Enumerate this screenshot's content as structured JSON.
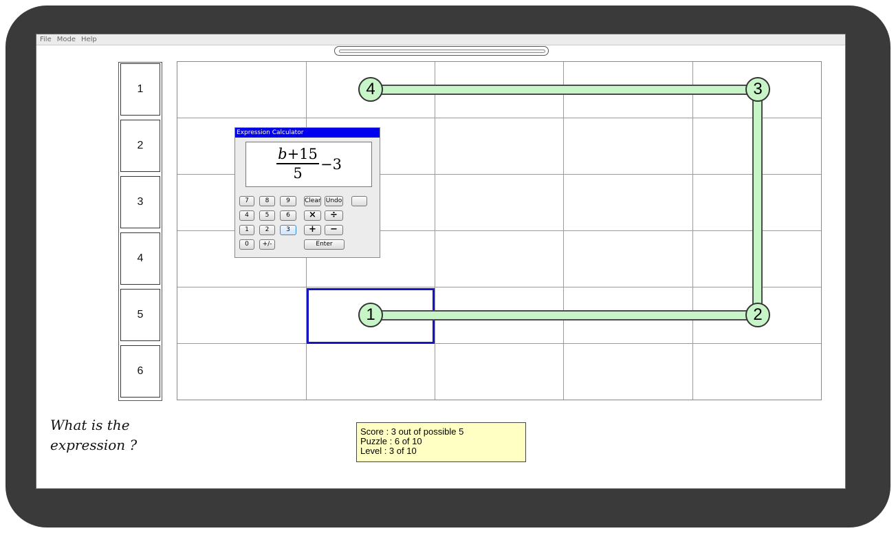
{
  "menu": [
    "File",
    "Mode",
    "Help"
  ],
  "row_labels": [
    "1",
    "2",
    "3",
    "4",
    "5",
    "6"
  ],
  "grid": {
    "columns": 5,
    "rows": 6
  },
  "path_nodes": [
    {
      "label": "1",
      "row": 5,
      "col": 2
    },
    {
      "label": "2",
      "row": 5,
      "col": 5
    },
    {
      "label": "3",
      "row": 1,
      "col": 5
    },
    {
      "label": "4",
      "row": 1,
      "col": 2
    }
  ],
  "selected_cell": {
    "row": 5,
    "col": 2
  },
  "calculator": {
    "title": "Expression Calculator",
    "expression": {
      "numerator_var": "b",
      "numerator_rest": "+15",
      "denominator": "5",
      "suffix": "−3"
    },
    "keys": [
      {
        "label": "7",
        "name": "key-7"
      },
      {
        "label": "8",
        "name": "key-8"
      },
      {
        "label": "9",
        "name": "key-9"
      },
      {
        "label": "Clear",
        "name": "clear-button"
      },
      {
        "label": "Undo",
        "name": "undo-button"
      },
      {
        "label": "",
        "name": "blank-button"
      },
      {
        "label": "4",
        "name": "key-4"
      },
      {
        "label": "5",
        "name": "key-5"
      },
      {
        "label": "6",
        "name": "key-6"
      },
      {
        "label": "×",
        "name": "multiply-button"
      },
      {
        "label": "÷",
        "name": "divide-button"
      },
      {
        "label": "1",
        "name": "key-1"
      },
      {
        "label": "2",
        "name": "key-2"
      },
      {
        "label": "3",
        "name": "key-3"
      },
      {
        "label": "+",
        "name": "plus-button"
      },
      {
        "label": "−",
        "name": "minus-button"
      },
      {
        "label": "0",
        "name": "key-0"
      },
      {
        "label": "+/-",
        "name": "sign-toggle-button"
      },
      {
        "label": "Enter",
        "name": "enter-button"
      }
    ]
  },
  "question_text": "What is the\nexpression ?",
  "status": {
    "score": "Score  : 3 out of possible 5",
    "puzzle": "Puzzle : 6 of 10",
    "level": "Level   : 3 of 10"
  }
}
